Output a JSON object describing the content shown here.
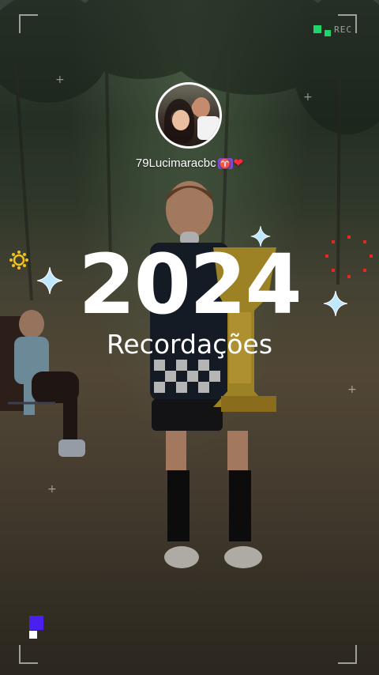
{
  "story": {
    "username": "79Lucimaracbc",
    "username_emoji_1": "♈",
    "username_emoji_2": "❤",
    "year": "2024",
    "subtitle": "Recordações",
    "rec_label": "REC"
  },
  "icons": {
    "avatar": "profile-avatar",
    "sparkles": [
      "sparkle-icon-left",
      "sparkle-icon-top-right",
      "sparkle-icon-right"
    ],
    "sun": "sun-icon",
    "dots": "dot-circle-icon",
    "rec_indicator": "rec-indicator-icon"
  },
  "colors": {
    "rec_green": "#1fd46a",
    "pixel_blue": "#4a1ff0",
    "heart_red": "#ff2a3a",
    "sun_yellow": "#f2c21a",
    "dots_red": "#e8281e"
  }
}
